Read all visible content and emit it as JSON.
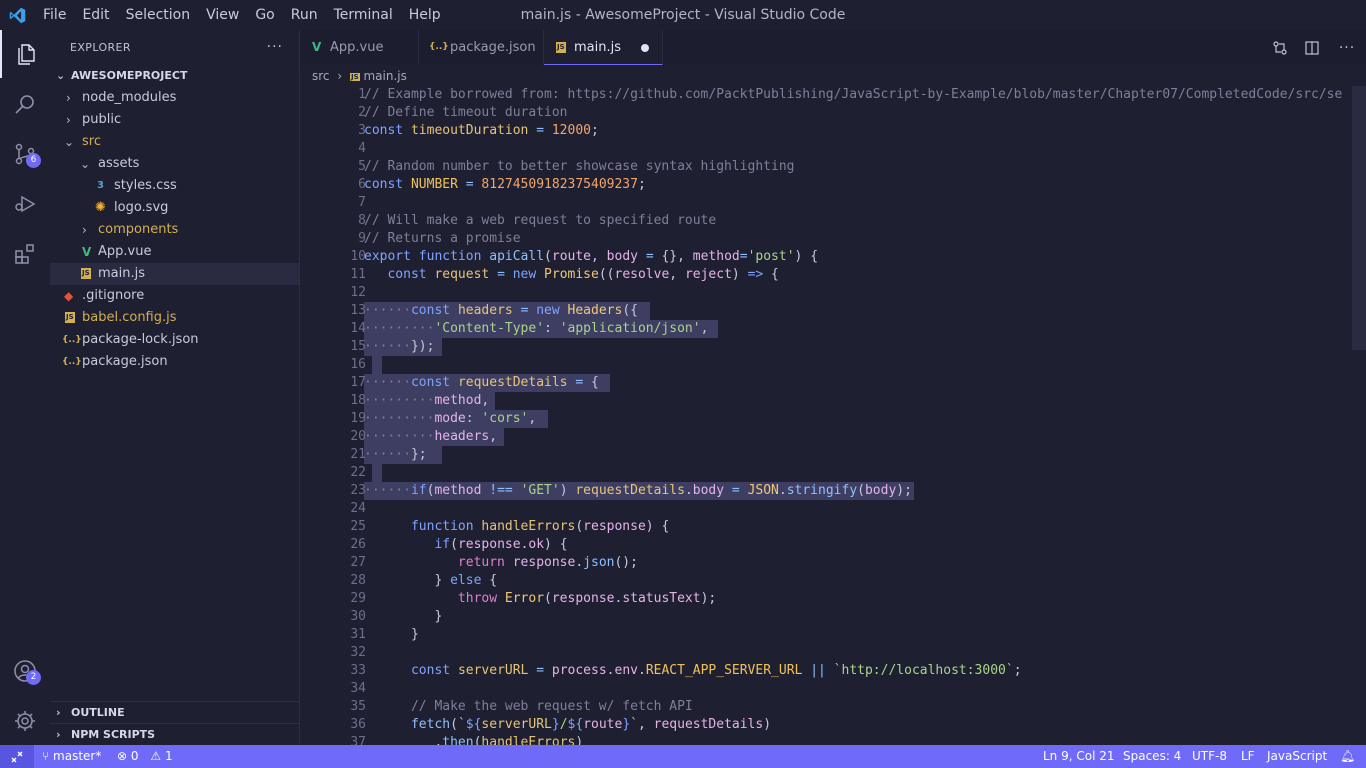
{
  "window": {
    "title": "main.js - AwesomeProject - Visual Studio Code",
    "menu": [
      "File",
      "Edit",
      "Selection",
      "View",
      "Go",
      "Run",
      "Terminal",
      "Help"
    ]
  },
  "activity_bar": {
    "items": [
      {
        "name": "explorer-icon"
      },
      {
        "name": "search-icon"
      },
      {
        "name": "source-control-icon",
        "badge": "6"
      },
      {
        "name": "run-debug-icon"
      },
      {
        "name": "extensions-icon"
      }
    ],
    "accounts_badge": "2"
  },
  "sidebar": {
    "title": "EXPLORER",
    "more": "···",
    "project": "AWESOMEPROJECT",
    "tree": [
      {
        "label": "node_modules",
        "icon": "chevron-right"
      },
      {
        "label": "public",
        "icon": "chevron-right"
      },
      {
        "label": "src",
        "icon": "chevron-down"
      },
      {
        "label": "assets",
        "icon": "chevron-down"
      },
      {
        "label": "styles.css",
        "icon": "css-file-icon"
      },
      {
        "label": "logo.svg",
        "icon": "svg-file-icon"
      },
      {
        "label": "components",
        "icon": "chevron-right"
      },
      {
        "label": "App.vue",
        "icon": "vue-file-icon"
      },
      {
        "label": "main.js",
        "icon": "js-file-icon"
      },
      {
        "label": ".gitignore",
        "icon": "git-file-icon"
      },
      {
        "label": "babel.config.js",
        "icon": "js-file-icon"
      },
      {
        "label": "package-lock.json",
        "icon": "json-file-icon"
      },
      {
        "label": "package.json",
        "icon": "json-file-icon"
      }
    ],
    "outline": "OUTLINE",
    "npm_scripts": "NPM SCRIPTS"
  },
  "tabs": [
    {
      "label": "App.vue",
      "icon_glyph": "V"
    },
    {
      "label": "package.json",
      "icon_glyph": "{..}"
    },
    {
      "label": "main.js",
      "icon_glyph": "JS",
      "active": true,
      "dirty": true
    }
  ],
  "breadcrumb": {
    "folder": "src",
    "sep": "›",
    "file": "main.js"
  },
  "editor": {
    "line_numbers": [
      "1",
      "2",
      "3",
      "4",
      "5",
      "6",
      "7",
      "8",
      "9",
      "10",
      "11",
      "12",
      "13",
      "14",
      "15",
      "16",
      "17",
      "18",
      "19",
      "20",
      "21",
      "22",
      "23",
      "24",
      "25",
      "26",
      "27",
      "28",
      "29",
      "30",
      "31",
      "32",
      "33",
      "34",
      "35",
      "36",
      "37"
    ]
  },
  "status": {
    "branch": "master*",
    "errors": "0",
    "warnings": "1",
    "position": "Ln 9, Col 21",
    "spaces": "Spaces: 4",
    "encoding": "UTF-8",
    "eol": "LF",
    "language": "JavaScript"
  },
  "colors": {
    "accent": "#6f6af8",
    "background": "#1e1f31",
    "selection": "#3d3e61"
  }
}
